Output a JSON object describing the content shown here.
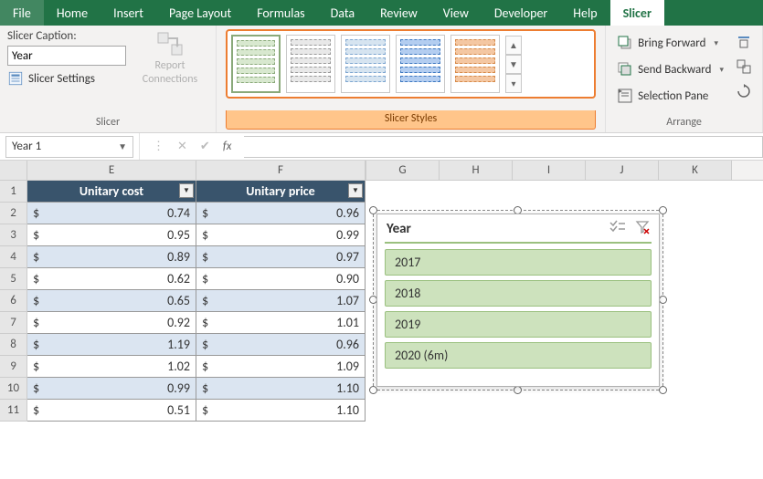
{
  "ribbon": {
    "tabs": [
      "File",
      "Home",
      "Insert",
      "Page Layout",
      "Formulas",
      "Data",
      "Review",
      "View",
      "Developer",
      "Help",
      "Slicer"
    ],
    "activeIndex": 10,
    "slicer_group_label": "Slicer",
    "caption_label": "Slicer Caption:",
    "caption_value": "Year",
    "settings_label": "Slicer Settings",
    "report_conn_line1": "Report",
    "report_conn_line2": "Connections",
    "styles_group_label": "Slicer Styles",
    "arrange_group_label": "Arrange",
    "bring_forward": "Bring Forward",
    "send_backward": "Send Backward",
    "selection_pane": "Selection Pane"
  },
  "formula_bar": {
    "name_box": "Year 1"
  },
  "columns": {
    "left": [
      "E",
      "F"
    ],
    "right": [
      "G",
      "H",
      "I",
      "J",
      "K"
    ]
  },
  "table": {
    "headers": [
      "Unitary cost",
      "Unitary price"
    ],
    "rows": [
      {
        "r": 1
      },
      {
        "r": 2,
        "cost": "0.74",
        "price": "0.96"
      },
      {
        "r": 3,
        "cost": "0.95",
        "price": "0.99"
      },
      {
        "r": 4,
        "cost": "0.89",
        "price": "0.97"
      },
      {
        "r": 5,
        "cost": "0.62",
        "price": "0.90"
      },
      {
        "r": 6,
        "cost": "0.65",
        "price": "1.07"
      },
      {
        "r": 7,
        "cost": "0.92",
        "price": "1.01"
      },
      {
        "r": 8,
        "cost": "1.19",
        "price": "0.96"
      },
      {
        "r": 9,
        "cost": "1.02",
        "price": "1.09"
      },
      {
        "r": 10,
        "cost": "0.99",
        "price": "1.10"
      },
      {
        "r": 11,
        "cost": "0.51",
        "price": "1.10"
      }
    ],
    "currency": "$"
  },
  "slicer": {
    "title": "Year",
    "items": [
      "2017",
      "2018",
      "2019",
      "2020 (6m)"
    ]
  }
}
